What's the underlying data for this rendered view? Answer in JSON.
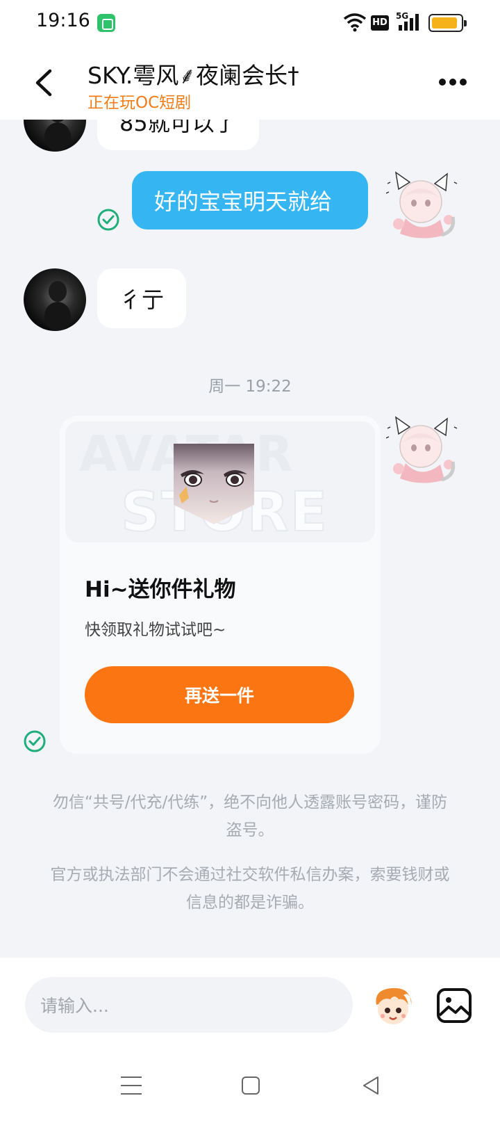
{
  "status_bar": {
    "time": "19:16",
    "network": "5G",
    "hd_label": "HD"
  },
  "header": {
    "title": "SKY.雩风⸙夜阑会长†",
    "subtitle": "正在玩OC短剧"
  },
  "messages": [
    {
      "side": "left",
      "text": "85就可以了"
    },
    {
      "side": "right",
      "text": "好的宝宝明天就给",
      "status": "read"
    },
    {
      "side": "left",
      "text": "彳亍"
    }
  ],
  "timestamp": "周一 19:22",
  "gift_card": {
    "banner_watermark_top": "AVATAR",
    "banner_watermark_bottom": "STORE",
    "title": "Hi~送你件礼物",
    "description": "快领取礼物试试吧~",
    "button_label": "再送一件",
    "status": "read"
  },
  "notices": [
    "勿信“共号/代充/代练”，绝不向他人透露账号密码，谨防盗号。",
    "官方或执法部门不会通过社交软件私信办案，索要钱财或信息的都是诈骗。"
  ],
  "input": {
    "placeholder": "请输入..."
  },
  "colors": {
    "accent_orange": "#fb7613",
    "bubble_blue": "#35b6f3",
    "read_green": "#1fae7a",
    "subtitle_orange": "#f07d18"
  },
  "icons": {
    "back": "chevron-left-icon",
    "more": "more-horizontal-icon",
    "emoji": "emoji-sticker-icon",
    "image": "image-icon",
    "check": "check-circle-icon"
  }
}
